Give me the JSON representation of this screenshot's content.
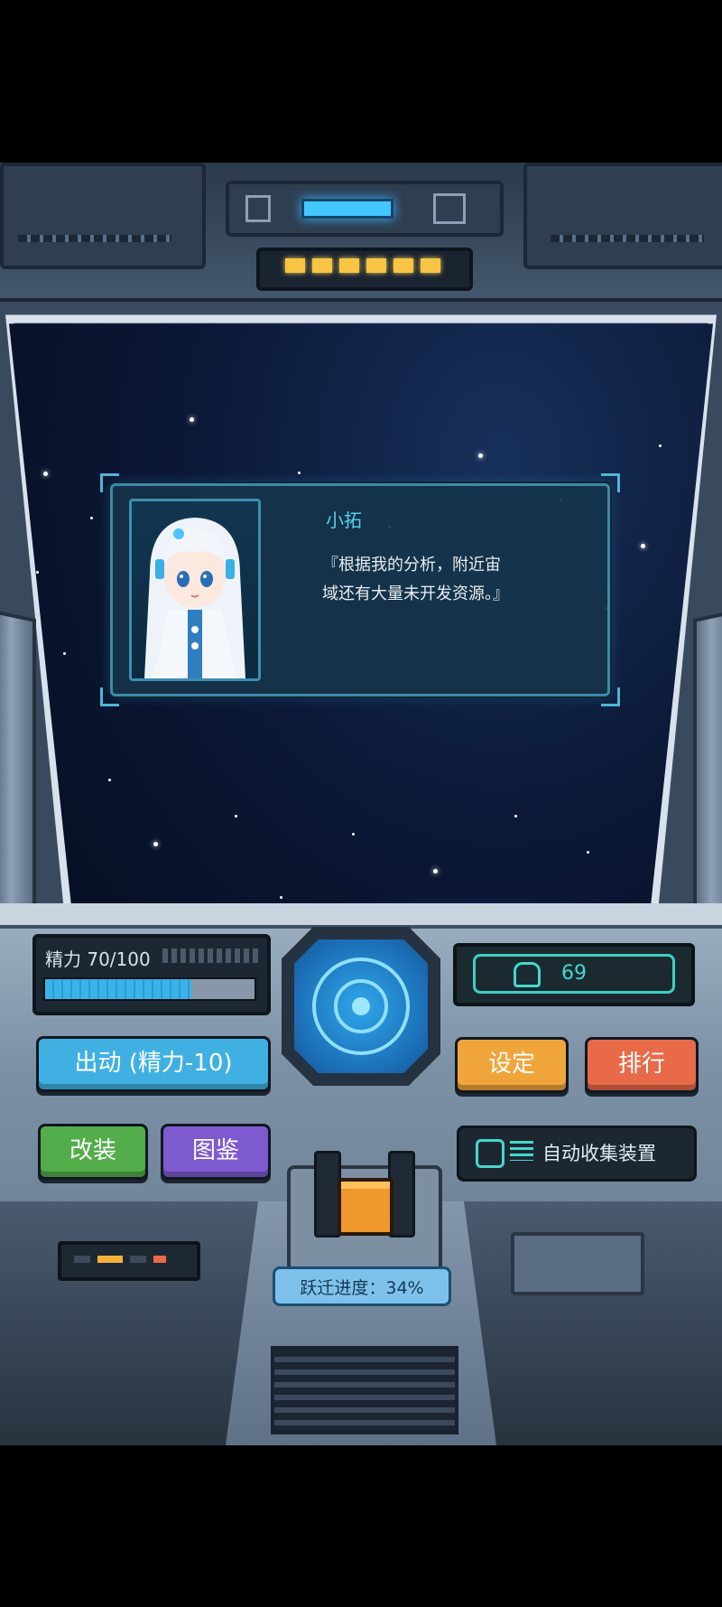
{
  "dialog": {
    "speaker": "小拓",
    "line1": "『根据我的分析，附近宙",
    "line2": "域还有大量未开发资源。』"
  },
  "stamina": {
    "label": "精力 70/100",
    "current": 70,
    "max": 100
  },
  "counter": {
    "value": "69",
    "icon": "helmet-icon"
  },
  "buttons": {
    "launch": "出动 (精力-10)",
    "settings": "设定",
    "rank": "排行",
    "mod": "改装",
    "dex": "图鉴",
    "auto_collect": "自动收集装置"
  },
  "jump": {
    "label": "跃迁进度：34%",
    "percent": 34
  },
  "colors": {
    "accent_cyan": "#40b0e2",
    "settings_orange": "#f0a53b",
    "rank_red": "#e86a48",
    "mod_green": "#53ad4a",
    "dex_purple": "#7e5ad0",
    "counter_teal": "#46d7cc"
  }
}
